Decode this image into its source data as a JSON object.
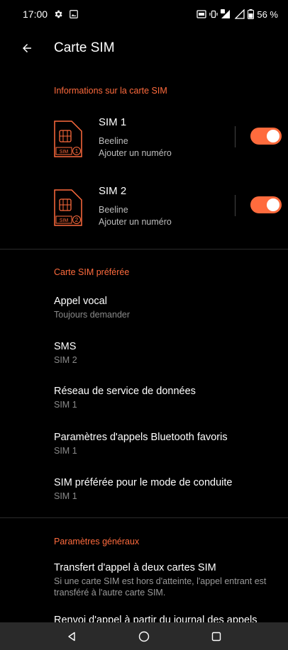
{
  "status": {
    "time": "17:00",
    "battery": "56 %"
  },
  "header": {
    "title": "Carte SIM"
  },
  "sim_info": {
    "header": "Informations sur la carte SIM",
    "sims": [
      {
        "name": "SIM 1",
        "operator": "Beeline",
        "action": "Ajouter un numéro",
        "badge": "SIM",
        "index": "1",
        "enabled": true
      },
      {
        "name": "SIM 2",
        "operator": "Beeline",
        "action": "Ajouter un numéro",
        "badge": "SIM",
        "index": "2",
        "enabled": true
      }
    ]
  },
  "preferred": {
    "header": "Carte SIM préférée",
    "items": [
      {
        "title": "Appel vocal",
        "value": "Toujours demander"
      },
      {
        "title": "SMS",
        "value": "SIM 2"
      },
      {
        "title": "Réseau de service de données",
        "value": "SIM 1"
      },
      {
        "title": "Paramètres d'appels Bluetooth favoris",
        "value": "SIM 1"
      },
      {
        "title": "SIM préférée pour le mode de conduite",
        "value": "SIM 1"
      }
    ]
  },
  "general": {
    "header": "Paramètres généraux",
    "items": [
      {
        "title": "Transfert d'appel à deux cartes SIM",
        "value": "Si une carte SIM est hors d'atteinte, l'appel entrant est transféré à l'autre carte SIM."
      },
      {
        "title": "Renvoi d'appel à partir du journal des appels"
      }
    ]
  },
  "colors": {
    "accent": "#ff6b3d",
    "background": "#000000"
  }
}
